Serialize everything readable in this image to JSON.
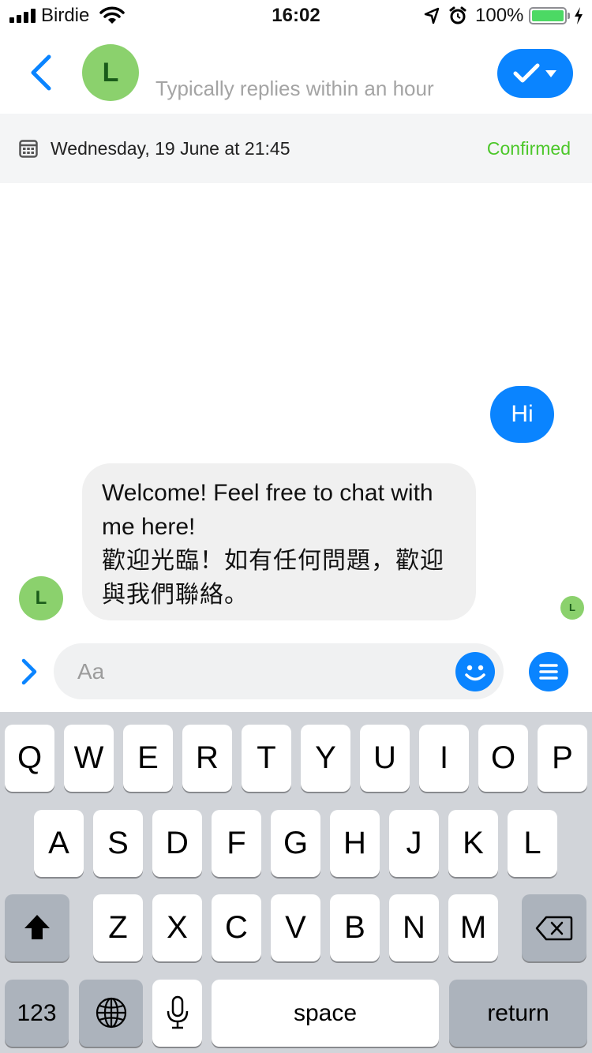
{
  "status_bar": {
    "carrier": "Birdie",
    "time": "16:02",
    "battery": "100%",
    "battery_level": 1.0,
    "icons": [
      "signal-icon",
      "wifi-icon",
      "location-icon",
      "alarm-icon",
      "battery-icon",
      "charging-icon"
    ]
  },
  "header": {
    "avatar_letter": "L",
    "subtitle": "Typically replies within an hour",
    "back_icon": "chevron-left-icon",
    "action_icon": "checkmark-icon"
  },
  "booking": {
    "icon": "calendar-icon",
    "datetime": "Wednesday, 19 June at 21:45",
    "status": "Confirmed",
    "status_color": "#4cc72a"
  },
  "messages": {
    "outgoing": {
      "text": "Hi"
    },
    "incoming": {
      "avatar_letter": "L",
      "line_en": "Welcome! Feel free to chat with me here!",
      "line_zh": "歡迎光臨！如有任何問題，歡迎與我們聯絡。"
    },
    "read_receipt_letter": "L"
  },
  "composer": {
    "placeholder": "Aa",
    "value": "",
    "icons": [
      "chevron-right-icon",
      "smiley-icon",
      "menu-icon"
    ]
  },
  "keyboard": {
    "row1": [
      "Q",
      "W",
      "E",
      "R",
      "T",
      "Y",
      "U",
      "I",
      "O",
      "P"
    ],
    "row2": [
      "A",
      "S",
      "D",
      "F",
      "G",
      "H",
      "J",
      "K",
      "L"
    ],
    "row3": [
      "Z",
      "X",
      "C",
      "V",
      "B",
      "N",
      "M"
    ],
    "numbers_label": "123",
    "space_label": "space",
    "return_label": "return",
    "icons": [
      "shift-icon",
      "backspace-icon",
      "globe-icon",
      "microphone-icon"
    ]
  },
  "colors": {
    "accent": "#0a84ff",
    "avatar": "#8bd16d",
    "keyboard_bg": "#d1d4d9"
  }
}
